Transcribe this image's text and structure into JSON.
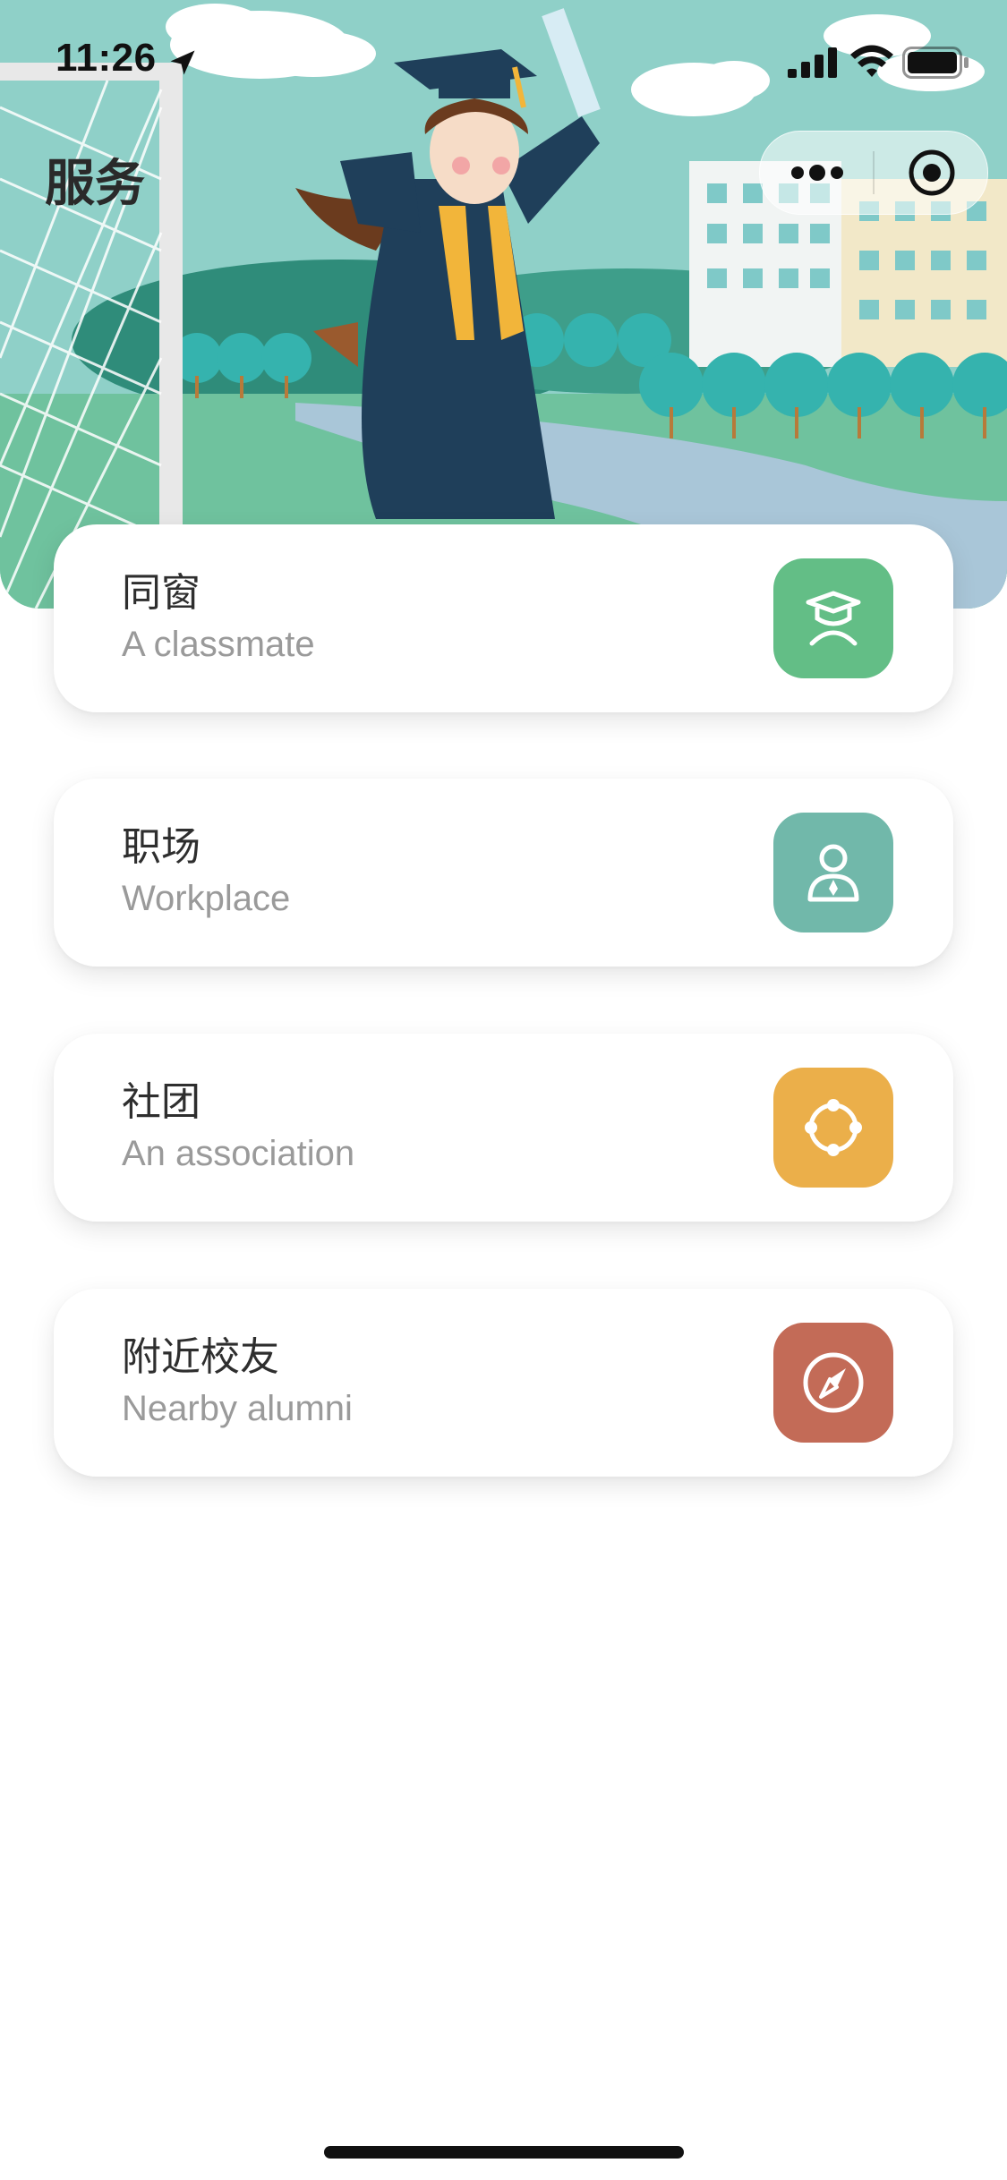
{
  "status_bar": {
    "time": "11:26",
    "icons": [
      "location-arrow-icon",
      "signal-icon",
      "wifi-icon",
      "battery-icon"
    ]
  },
  "header": {
    "title": "服务",
    "capsule": {
      "more_icon": "more-dots-icon",
      "close_icon": "target-icon"
    }
  },
  "services": [
    {
      "title": "同窗",
      "subtitle": "A classmate",
      "icon": "graduate-icon",
      "color": "#63BE86"
    },
    {
      "title": "职场",
      "subtitle": "Workplace",
      "icon": "user-tie-icon",
      "color": "#71B8AA"
    },
    {
      "title": "社团",
      "subtitle": "An association",
      "icon": "orbit-icon",
      "color": "#EBAF4A"
    },
    {
      "title": "附近校友",
      "subtitle": "Nearby alumni",
      "icon": "compass-icon",
      "color": "#C36B57"
    }
  ]
}
